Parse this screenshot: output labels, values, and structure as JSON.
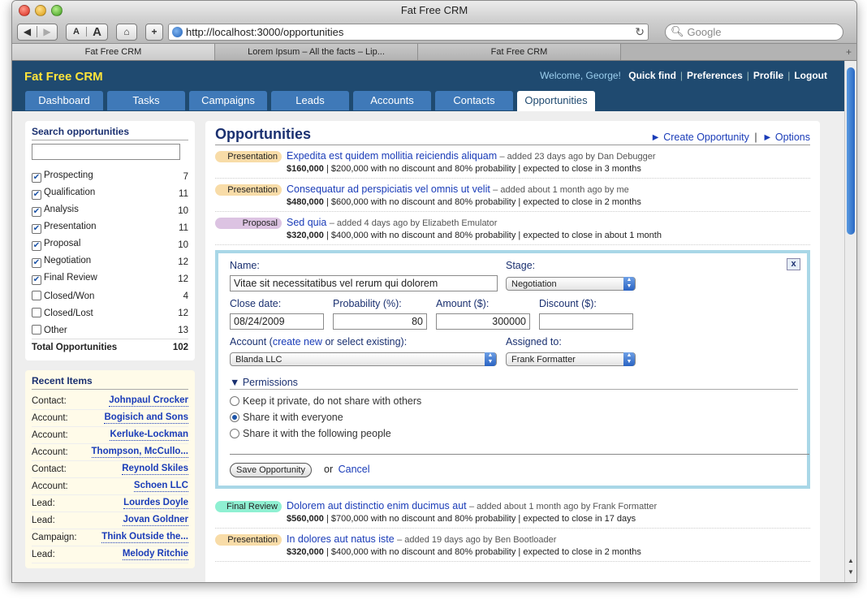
{
  "browser": {
    "window_title": "Fat Free CRM",
    "url": "http://localhost:3000/opportunities",
    "search_placeholder": "Google",
    "tabs": [
      "Fat Free CRM",
      "Lorem Ipsum – All the facts – Lip...",
      "Fat Free CRM"
    ],
    "font_small": "A",
    "font_large": "A",
    "new_tab": "+"
  },
  "header": {
    "logo": "Fat Free CRM",
    "welcome": "Welcome, George!",
    "links": [
      "Quick find",
      "Preferences",
      "Profile",
      "Logout"
    ]
  },
  "nav": [
    "Dashboard",
    "Tasks",
    "Campaigns",
    "Leads",
    "Accounts",
    "Contacts",
    "Opportunities"
  ],
  "sidebar": {
    "search_title": "Search opportunities",
    "filters": [
      {
        "label": "Prospecting",
        "count": "7",
        "checked": true
      },
      {
        "label": "Qualification",
        "count": "11",
        "checked": true
      },
      {
        "label": "Analysis",
        "count": "10",
        "checked": true
      },
      {
        "label": "Presentation",
        "count": "11",
        "checked": true
      },
      {
        "label": "Proposal",
        "count": "10",
        "checked": true
      },
      {
        "label": "Negotiation",
        "count": "12",
        "checked": true
      },
      {
        "label": "Final Review",
        "count": "12",
        "checked": true
      },
      {
        "label": "Closed/Won",
        "count": "4",
        "checked": false
      },
      {
        "label": "Closed/Lost",
        "count": "12",
        "checked": false
      },
      {
        "label": "Other",
        "count": "13",
        "checked": false
      }
    ],
    "total_label": "Total Opportunities",
    "total_count": "102",
    "recent_title": "Recent Items",
    "recent": [
      {
        "type": "Contact:",
        "name": "Johnpaul Crocker"
      },
      {
        "type": "Account:",
        "name": "Bogisich and Sons"
      },
      {
        "type": "Account:",
        "name": "Kerluke-Lockman"
      },
      {
        "type": "Account:",
        "name": "Thompson, McCullo..."
      },
      {
        "type": "Contact:",
        "name": "Reynold Skiles"
      },
      {
        "type": "Account:",
        "name": "Schoen LLC"
      },
      {
        "type": "Lead:",
        "name": "Lourdes Doyle"
      },
      {
        "type": "Lead:",
        "name": "Jovan Goldner"
      },
      {
        "type": "Campaign:",
        "name": "Think Outside the..."
      },
      {
        "type": "Lead:",
        "name": "Melody Ritchie"
      }
    ]
  },
  "main": {
    "title": "Opportunities",
    "create_link": "► Create Opportunity",
    "separator": "|",
    "options_link": "► Options",
    "opportunities_before": [
      {
        "stage": "Presentation",
        "color": "#f8dca8",
        "name": "Expedita est quidem mollitia reiciendis aliquam",
        "meta": "– added 23 days ago by Dan Debugger",
        "amount": "$160,000",
        "details": "| $200,000 with no discount and 80% probability | expected to close in 3 months"
      },
      {
        "stage": "Presentation",
        "color": "#f8dca8",
        "name": "Consequatur ad perspiciatis vel omnis ut velit",
        "meta": "– added about 1 month ago by me",
        "amount": "$480,000",
        "details": "| $600,000 with no discount and 80% probability | expected to close in 2 months"
      },
      {
        "stage": "Proposal",
        "color": "#dcc3e2",
        "name": "Sed quia",
        "meta": "– added 4 days ago by Elizabeth Emulator",
        "amount": "$320,000",
        "details": "| $400,000 with no discount and 80% probability | expected to close in about 1 month"
      }
    ],
    "opportunities_after": [
      {
        "stage": "Final Review",
        "color": "#8ff0d2",
        "name": "Dolorem aut distinctio enim ducimus aut",
        "meta": "– added about 1 month ago by Frank Formatter",
        "amount": "$560,000",
        "details": "| $700,000 with no discount and 80% probability | expected to close in 17 days"
      },
      {
        "stage": "Presentation",
        "color": "#f8dca8",
        "name": "In dolores aut natus iste",
        "meta": "– added 19 days ago by Ben Bootloader",
        "amount": "$320,000",
        "details": "| $400,000 with no discount and 80% probability | expected to close in 2 months"
      }
    ]
  },
  "form": {
    "close_btn": "x",
    "name_label": "Name:",
    "name_value": "Vitae sit necessitatibus vel rerum qui dolorem",
    "stage_label": "Stage:",
    "stage_value": "Negotiation",
    "close_date_label": "Close date:",
    "close_date_value": "08/24/2009",
    "probability_label": "Probability (%):",
    "probability_value": "80",
    "amount_label": "Amount ($):",
    "amount_value": "300000",
    "discount_label": "Discount ($):",
    "discount_value": "",
    "account_label_pre": "Account (",
    "account_create_link": "create new",
    "account_label_post": " or select existing):",
    "account_value": "Blanda LLC",
    "assigned_label": "Assigned to:",
    "assigned_value": "Frank Formatter",
    "permissions_title": "▼ Permissions",
    "perm_options": [
      "Keep it private, do not share with others",
      "Share it with everyone",
      "Share it with the following people"
    ],
    "perm_selected": 1,
    "save_label": "Save Opportunity",
    "or_text": "or",
    "cancel_label": "Cancel"
  }
}
